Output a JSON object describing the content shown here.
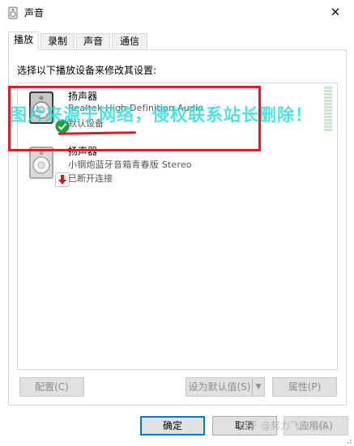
{
  "window": {
    "title": "声音",
    "close_glyph": "✕"
  },
  "tabs": [
    {
      "label": "播放",
      "active": true
    },
    {
      "label": "录制",
      "active": false
    },
    {
      "label": "声音",
      "active": false
    },
    {
      "label": "通信",
      "active": false
    }
  ],
  "panel": {
    "instruction": "选择以下播放设备来修改其设置:"
  },
  "devices": [
    {
      "name": "扬声器",
      "description": "Realtek High Definition Audio",
      "status": "默认设备",
      "badge": "check-badge-icon",
      "badge_color": "#1e9e3f"
    },
    {
      "name": "扬声器",
      "description": "小钢炮蓝牙音箱青春版 Stereo",
      "status": "已断开连接",
      "badge": "disconnected-arrow-icon",
      "badge_color": "#d01a1a"
    }
  ],
  "overlay": {
    "watermark": "图片来源于网络，侵权联系站长删除！",
    "credit": "知乎 @努力飞的小鱼",
    "highlight_color": "#e01b2c"
  },
  "buttons": {
    "configure": "配置(C)",
    "set_default": "设为默认值(S)",
    "properties": "属性(P)",
    "ok": "确定",
    "cancel": "取消",
    "apply": "应用(A)"
  },
  "colors": {
    "focus_border": "#0078d7",
    "watermark": "#28dcd7"
  }
}
